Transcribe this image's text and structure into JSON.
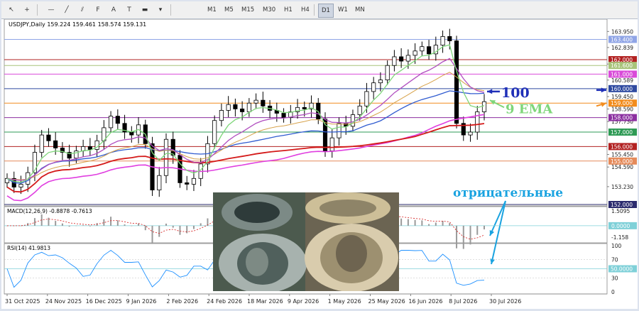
{
  "toolbar": {
    "timeframes": [
      "M1",
      "M5",
      "M15",
      "M30",
      "H1",
      "H4",
      "D1",
      "W1",
      "MN"
    ],
    "active_timeframe": "D1",
    "tools": [
      "cursor-icon",
      "crosshair-icon",
      "hline-icon",
      "trendline-icon",
      "channel-icon",
      "fibo-icon",
      "text-icon",
      "label-icon",
      "rectangle-icon",
      "shapes-icon"
    ]
  },
  "chart_data": [
    {
      "type": "line",
      "subtype": "candlestick",
      "title": "USDJPY,Daily  159.224 159.461 158.574 159.131",
      "ohlc_last": {
        "open": 159.224,
        "high": 159.461,
        "low": 158.574,
        "close": 159.131
      },
      "ylim": [
        152.0,
        164.6
      ],
      "y_ticks": [
        163.95,
        162.839,
        161.7,
        160.589,
        159.45,
        158.59,
        157.73,
        155.45,
        154.59,
        153.23
      ],
      "x_ticks": [
        "31 Oct 2025",
        "24 Nov 2025",
        "16 Dec 2025",
        "9 Jan 2026",
        "2 Feb 2026",
        "24 Feb 2026",
        "18 Mar 2026",
        "9 Apr 2026",
        "1 May 2026",
        "25 May 2026",
        "16 Jun 2026",
        "8 Jul 2026",
        "30 Jul 2026"
      ],
      "close_series": [
        153.8,
        153.2,
        153.4,
        154.2,
        155.6,
        156.8,
        156.4,
        155.9,
        155.6,
        155.2,
        155.7,
        156.0,
        155.8,
        156.4,
        157.3,
        158.1,
        157.6,
        157.0,
        156.8,
        157.5,
        156.2,
        153.0,
        154.0,
        156.5,
        155.4,
        153.5,
        153.4,
        153.8,
        154.8,
        156.2,
        157.8,
        158.5,
        158.9,
        158.6,
        158.4,
        159.0,
        159.2,
        158.8,
        158.5,
        158.3,
        158.0,
        158.4,
        158.7,
        158.6,
        159.0,
        157.9,
        155.7,
        156.6,
        157.6,
        157.4,
        158.2,
        158.8,
        159.8,
        160.4,
        160.6,
        161.6,
        162.2,
        161.9,
        162.3,
        162.6,
        162.9,
        162.4,
        163.0,
        163.6,
        163.3,
        157.6,
        156.8,
        157.0,
        158.4,
        159.1
      ],
      "horizontal_levels": [
        {
          "value": 163.4,
          "label": "163.400",
          "color": "#8fa4e6"
        },
        {
          "value": 162.0,
          "label": "162.000",
          "color": "#b22222"
        },
        {
          "value": 161.6,
          "label": "161.600",
          "color": "#a8c47a"
        },
        {
          "value": 161.0,
          "label": "161.000",
          "color": "#d94bd9"
        },
        {
          "value": 160.0,
          "label": "160.000",
          "color": "#2f4aa0"
        },
        {
          "value": 159.0,
          "label": "159.000",
          "color": "#f28c1e"
        },
        {
          "value": 158.0,
          "label": "158.000",
          "color": "#8b2fa0"
        },
        {
          "value": 157.0,
          "label": "157.000",
          "color": "#2e9a55"
        },
        {
          "value": 156.0,
          "label": "156.000",
          "color": "#b22222"
        },
        {
          "value": 155.0,
          "label": "155.000",
          "color": "#e58a5a"
        },
        {
          "value": 152.0,
          "label": "152.000",
          "color": "#2b2b6e"
        }
      ],
      "moving_averages": [
        {
          "name": "9 EMA",
          "color": "#7fd67a"
        },
        {
          "name": "100",
          "color": "#2f5bd0"
        }
      ],
      "annotations": [
        {
          "text": "100",
          "color": "#1f2fb8"
        },
        {
          "text": "9 EMA",
          "color": "#7fd67a"
        },
        {
          "text": "отрицательные",
          "color": "#1aa3e0"
        }
      ]
    },
    {
      "type": "bar",
      "title": "MACD(12,26,9) -0.8878 -0.7613",
      "main": -0.8878,
      "signal": -0.7613,
      "y_ticks": [
        1.5095,
        0.0,
        -1.158
      ],
      "level_label": "0.0000"
    },
    {
      "type": "line",
      "title": "RSI(14) 41.9813",
      "value": 41.9813,
      "y_ticks": [
        100,
        70,
        30,
        0
      ],
      "level_label": "50.0000",
      "ylim": [
        0,
        100
      ]
    }
  ],
  "colors": {
    "accent": "#1f2fb8",
    "background": "#ffffff",
    "frame": "#7a86a8"
  }
}
